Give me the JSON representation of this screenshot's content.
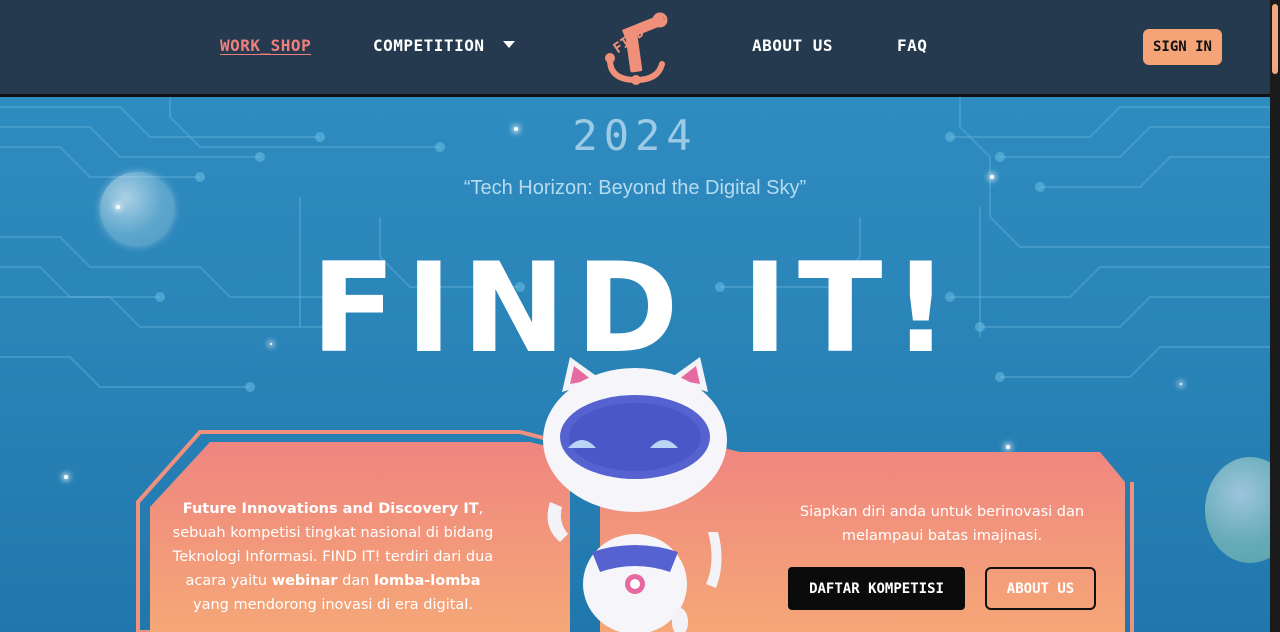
{
  "nav": {
    "workshop": "WORK_SHOP",
    "competition": "COMPETITION",
    "about": "ABOUT US",
    "faq": "FAQ",
    "signin": "SIGN IN",
    "logo_text": "FIND"
  },
  "hero": {
    "year": "2024",
    "tagline": "“Tech Horizon: Beyond the Digital Sky”",
    "title": "FIND IT!",
    "desc": {
      "lead_bold": "Future Innovations and Discovery IT",
      "lead_rest": ", sebuah kompetisi tingkat nasional di bidang Teknologi Informasi. FIND IT! terdiri dari dua acara yaitu ",
      "webinar": "webinar",
      "mid": " dan ",
      "lomba": "lomba-lomba",
      "tail": " yang mendorong inovasi di era digital."
    },
    "right_text": "Siapkan diri anda untuk berinovasi dan melampaui batas imajinasi.",
    "daftar_button": "DAFTAR KOMPETISI",
    "about_button": "ABOUT US"
  },
  "colors": {
    "header_bg": "#253a4f",
    "accent": "#ef7f7c",
    "signin_bg": "#f4a477",
    "hero_bg": "#2a84b8",
    "panel": "#f2907e"
  }
}
